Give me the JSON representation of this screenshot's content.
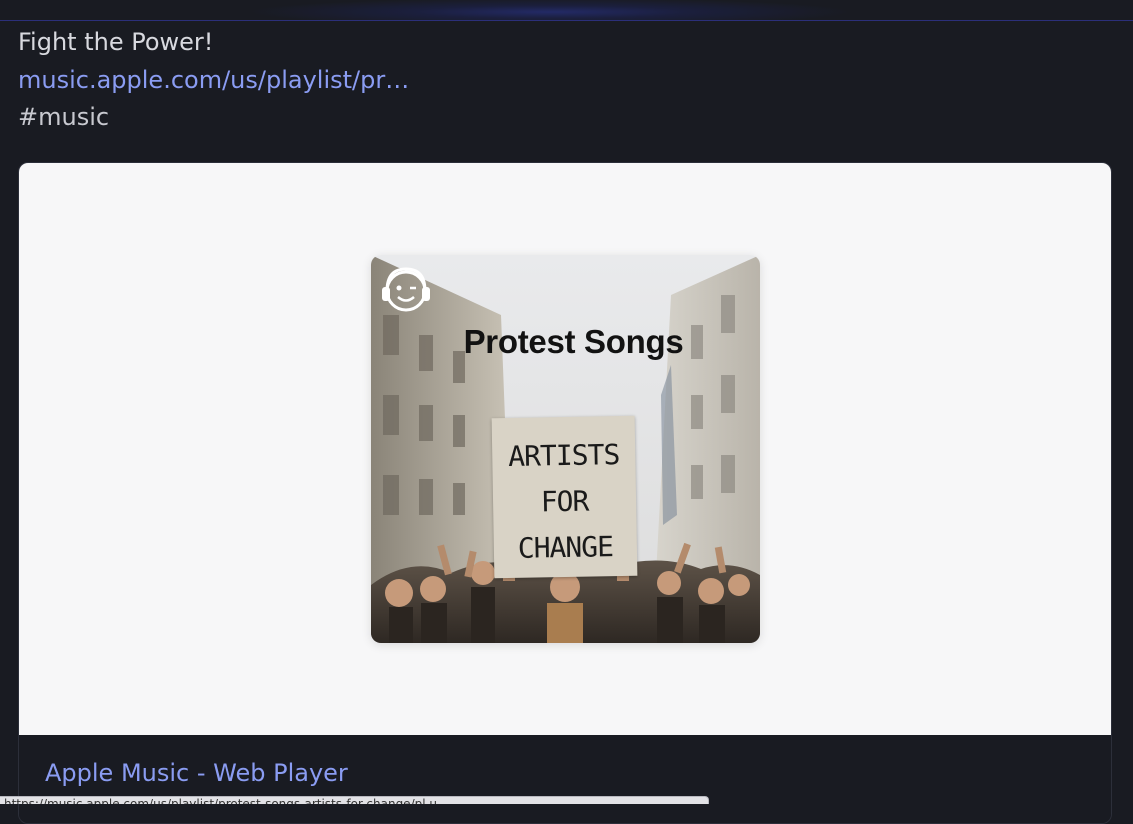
{
  "post": {
    "text": "Fight the Power!",
    "link": "music.apple.com/us/playlist/pr…",
    "hashtag": "#music"
  },
  "card": {
    "cover": {
      "title": "Protest Songs",
      "sign_lines": [
        "ARTISTS",
        "FOR",
        "CHANGE"
      ],
      "logo_icon": "headphones-face-icon"
    },
    "footer_title": "Apple Music - Web Player"
  },
  "status_bar": {
    "url": "https://music.apple.com/us/playlist/protest-songs-artists-for-change/pl.u-..."
  },
  "colors": {
    "background": "#191b22",
    "link": "#8a9cf2",
    "text": "#d8d9df",
    "card_image_bg": "#f7f7f8"
  }
}
